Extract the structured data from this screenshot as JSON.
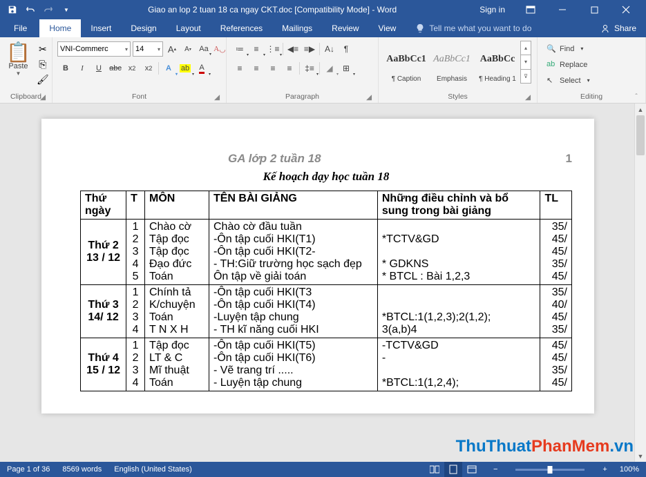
{
  "titlebar": {
    "title": "Giao an lop 2 tuan 18 ca ngay CKT.doc  [Compatibility Mode]  -  Word",
    "signin": "Sign in"
  },
  "tabs": {
    "file": "File",
    "home": "Home",
    "insert": "Insert",
    "design": "Design",
    "layout": "Layout",
    "references": "References",
    "mailings": "Mailings",
    "review": "Review",
    "view": "View",
    "tellme": "Tell me what you want to do",
    "share": "Share"
  },
  "ribbon": {
    "clipboard": {
      "paste": "Paste",
      "label": "Clipboard"
    },
    "font": {
      "name": "VNI-Commerc",
      "size": "14",
      "label": "Font",
      "bold": "B",
      "italic": "I",
      "underline": "U",
      "grow": "A",
      "shrink": "A",
      "caps": "Aa"
    },
    "paragraph": {
      "label": "Paragraph"
    },
    "styles": {
      "label": "Styles",
      "items": [
        {
          "preview": "AaBbCc1",
          "name": "¶ Caption"
        },
        {
          "preview": "AaBbCc1",
          "name": "Emphasis"
        },
        {
          "preview": "AaBbCc",
          "name": "¶ Heading 1"
        }
      ]
    },
    "editing": {
      "label": "Editing",
      "find": "Find",
      "replace": "Replace",
      "select": "Select"
    }
  },
  "document": {
    "header_title": "GA lớp 2 tuần 18",
    "header_page": "1",
    "title": "Kế hoạch dạy học tuần 18",
    "headers": {
      "day": "Thứ ngày",
      "t": "T",
      "subject": "MÔN",
      "topic": "TÊN    BÀI  GIẢNG",
      "adjust": "Những điều chỉnh và bổ sung trong bài giảng",
      "tl": "TL"
    },
    "rows": [
      {
        "day": "Thứ 2\n13 / 12",
        "t": "1\n2\n3\n4\n5",
        "subject": "Chào cờ\nTập đọc\nTập đọc\nĐạo đức\nToán",
        "topic": "Chào cờ đầu tuần\n-Ôn tập cuối HKI(T1)\n-Ôn tập cuối HKI(T2-\n- TH:Giữ trường học sạch đẹp\nÔn tập về giải toán",
        "adjust": "\n*TCTV&GD\n\n * GDKNS\n* BTCL : Bài 1,2,3",
        "tl": "35/\n45/\n45/\n35/\n45/"
      },
      {
        "day": "Thứ 3\n14/ 12",
        "t": "1\n2\n3\n4",
        "subject": "Chính tả\nK/chuyện\n Toán\nT N X H",
        "topic": "-Ôn tập cuối HKI(T3\n-Ôn tập cuối HKI(T4)\n-Luyện tập chung\n- TH kĩ năng cuối HKI",
        "adjust": "\n\n*BTCL:1(1,2,3);2(1,2);\n3(a,b)4",
        "tl": "35/\n40/\n45/\n35/"
      },
      {
        "day": "Thứ 4\n15 / 12",
        "t": "1\n2\n3\n4",
        "subject": "Tập đọc\nLT & C\nMĩ thuật\nToán",
        "topic": "-Ôn tập cuối HKI(T5)\n-Ôn tập cuối HKI(T6)\n- Vẽ trang trí .....\n- Luyện tập chung",
        "adjust": "-TCTV&GD\n-\n\n*BTCL:1(1,2,4);",
        "tl": "45/\n45/\n35/\n45/"
      }
    ]
  },
  "statusbar": {
    "page": "Page 1 of 36",
    "words": "8569 words",
    "lang": "English (United States)",
    "zoom": "100%"
  },
  "watermark": {
    "a": "ThuThuat",
    "b": "PhanMem",
    "c": ".vn"
  }
}
